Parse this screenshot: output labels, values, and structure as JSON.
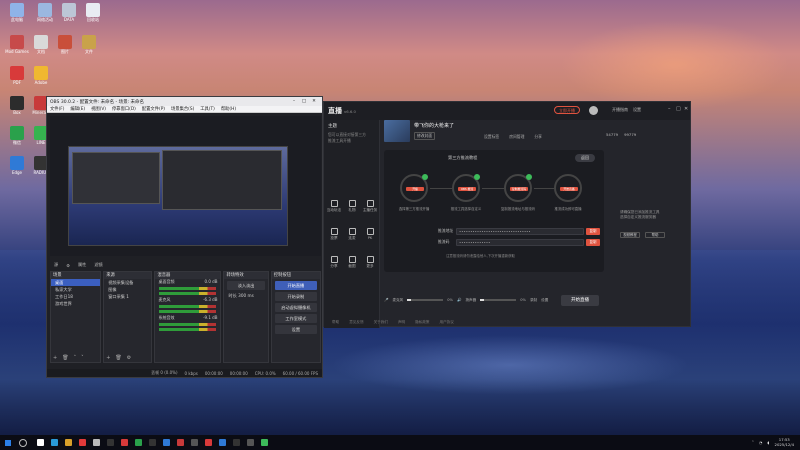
{
  "desktop_icons": [
    {
      "label": "此电脑",
      "color": "#8fb3e8"
    },
    {
      "label": "网络活动",
      "color": "#9bb7e0"
    },
    {
      "label": "DATA",
      "color": "#bcc6d6"
    },
    {
      "label": "回收站",
      "color": "#e8ecf2"
    },
    {
      "label": "Mod Games",
      "color": "#c74a4a"
    },
    {
      "label": "文档",
      "color": "#d9d9d9"
    },
    {
      "label": "图片",
      "color": "#c94f3a"
    },
    {
      "label": "文件",
      "color": "#c9a24a"
    },
    {
      "label": "PDF",
      "color": "#d83a3a"
    },
    {
      "label": "Adobe",
      "color": "#f0b830"
    },
    {
      "label": "Box",
      "color": "#2c2c2c"
    },
    {
      "label": "Mineralp",
      "color": "#c83a3a"
    },
    {
      "label": "微信",
      "color": "#2aa14b"
    },
    {
      "label": "LINE",
      "color": "#36b34f"
    },
    {
      "label": "Edge",
      "color": "#2f7ad6"
    },
    {
      "label": "RADIUS",
      "color": "#333"
    }
  ],
  "obs": {
    "title": "OBS 30.0.2 - 配置文件: 未命名 - 场景: 未命名",
    "menu": [
      "文件(F)",
      "编辑(E)",
      "视图(V)",
      "停靠窗口(D)",
      "配置文件(P)",
      "场景集合(S)",
      "工具(T)",
      "帮助(H)"
    ],
    "preview_bar": [
      "源",
      "属性",
      "滤镜"
    ],
    "docks": {
      "scenes": {
        "title": "场景",
        "items": [
          "桌面",
          "私家大学",
          "工作日18",
          "游戏世界"
        ],
        "selected": 0
      },
      "sources": {
        "title": "来源",
        "items": [
          "视频采集设备",
          "图像",
          "窗口采集 1"
        ]
      },
      "mixer": {
        "title": "混音器",
        "channels": [
          "桌面音频",
          "麦克风",
          "系统音效"
        ],
        "levels": [
          "0.0 dB",
          "-6.3 dB",
          "-9.1 dB"
        ]
      },
      "transitions": {
        "title": "转场特效",
        "type": "淡入淡出",
        "duration_label": "时长",
        "duration": "300 ms"
      },
      "controls": {
        "title": "控制按钮",
        "buttons": [
          "开始直播",
          "开始录制",
          "启动虚拟摄像机",
          "工作室模式",
          "设置"
        ]
      }
    },
    "status": [
      "丢帧 0 (0.0%)",
      "0 kbps",
      "00:00:00",
      "00:00:00",
      "CPU: 0.0%",
      "60.00 / 60.00 FPS"
    ]
  },
  "app": {
    "logo": "直播",
    "version": "v6.6.0",
    "rec_label": "立即开播",
    "top_right": [
      "开播指南",
      "设置"
    ],
    "left_title": "主题",
    "left_text": [
      "您可以直接对接第三方",
      "推流工具开播"
    ],
    "tools": [
      "互动玩法",
      "礼物",
      "主播任务",
      "投票",
      "连麦",
      "PK",
      "分享",
      "截图",
      "更多"
    ],
    "room": {
      "title": "带飞你的大枪来了",
      "tag": "修改封面",
      "meta": [
        "设置标签",
        "房间管理",
        "分享"
      ]
    },
    "stats": [
      "54779",
      "99779"
    ],
    "panel_title": "第三方推流教程",
    "panel_btn": "返回",
    "steps": [
      "开播",
      "OBS 推流",
      "复制推流码",
      "开始直播"
    ],
    "step_labels": [
      "选择第三方推流开播",
      "推流工具选择自定义",
      "复制推流地址与推流码",
      "推流成功即可直播"
    ],
    "fields": [
      {
        "label": "推流地址",
        "value": "••••••••••••••••••••••••••••••••",
        "btn": "复制"
      },
      {
        "label": "推流码",
        "value": "••••••••••••••",
        "btn": "复制"
      }
    ],
    "hint": "注意推流码请勿泄露给他人,下次开播重新获取",
    "side_text": [
      "请确保您已添加推流工具",
      "选择自定义推流服务器"
    ],
    "side_btns": [
      "视频教程",
      "帮助"
    ],
    "mixer": [
      "麦克风",
      "0%",
      "扬声器",
      "0%",
      "录制",
      "设置"
    ],
    "go_live": "开始直播",
    "bottom": [
      "帮助",
      "意见反馈",
      "关于我们",
      "声明",
      "隐私政策",
      "用户协议"
    ]
  },
  "taskbar": {
    "time": "17:53",
    "date": "2025/12/4",
    "icons": [
      "#ffffff",
      "#2a9bd8",
      "#d8a02a",
      "#e23a3a",
      "#bbbbbb",
      "#333",
      "#d83a3a",
      "#2aa14b",
      "#333",
      "#2f7ad6",
      "#c83a3a",
      "#555",
      "#d83a3a",
      "#2f7ad6",
      "#333",
      "#555",
      "#3dbb5a"
    ]
  }
}
